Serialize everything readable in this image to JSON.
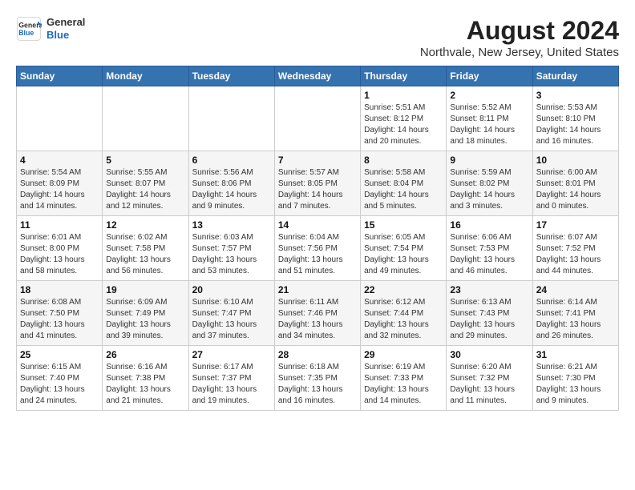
{
  "header": {
    "logo_line1": "General",
    "logo_line2": "Blue",
    "title": "August 2024",
    "subtitle": "Northvale, New Jersey, United States"
  },
  "weekdays": [
    "Sunday",
    "Monday",
    "Tuesday",
    "Wednesday",
    "Thursday",
    "Friday",
    "Saturday"
  ],
  "weeks": [
    [
      {
        "day": "",
        "info": ""
      },
      {
        "day": "",
        "info": ""
      },
      {
        "day": "",
        "info": ""
      },
      {
        "day": "",
        "info": ""
      },
      {
        "day": "1",
        "info": "Sunrise: 5:51 AM\nSunset: 8:12 PM\nDaylight: 14 hours\nand 20 minutes."
      },
      {
        "day": "2",
        "info": "Sunrise: 5:52 AM\nSunset: 8:11 PM\nDaylight: 14 hours\nand 18 minutes."
      },
      {
        "day": "3",
        "info": "Sunrise: 5:53 AM\nSunset: 8:10 PM\nDaylight: 14 hours\nand 16 minutes."
      }
    ],
    [
      {
        "day": "4",
        "info": "Sunrise: 5:54 AM\nSunset: 8:09 PM\nDaylight: 14 hours\nand 14 minutes."
      },
      {
        "day": "5",
        "info": "Sunrise: 5:55 AM\nSunset: 8:07 PM\nDaylight: 14 hours\nand 12 minutes."
      },
      {
        "day": "6",
        "info": "Sunrise: 5:56 AM\nSunset: 8:06 PM\nDaylight: 14 hours\nand 9 minutes."
      },
      {
        "day": "7",
        "info": "Sunrise: 5:57 AM\nSunset: 8:05 PM\nDaylight: 14 hours\nand 7 minutes."
      },
      {
        "day": "8",
        "info": "Sunrise: 5:58 AM\nSunset: 8:04 PM\nDaylight: 14 hours\nand 5 minutes."
      },
      {
        "day": "9",
        "info": "Sunrise: 5:59 AM\nSunset: 8:02 PM\nDaylight: 14 hours\nand 3 minutes."
      },
      {
        "day": "10",
        "info": "Sunrise: 6:00 AM\nSunset: 8:01 PM\nDaylight: 14 hours\nand 0 minutes."
      }
    ],
    [
      {
        "day": "11",
        "info": "Sunrise: 6:01 AM\nSunset: 8:00 PM\nDaylight: 13 hours\nand 58 minutes."
      },
      {
        "day": "12",
        "info": "Sunrise: 6:02 AM\nSunset: 7:58 PM\nDaylight: 13 hours\nand 56 minutes."
      },
      {
        "day": "13",
        "info": "Sunrise: 6:03 AM\nSunset: 7:57 PM\nDaylight: 13 hours\nand 53 minutes."
      },
      {
        "day": "14",
        "info": "Sunrise: 6:04 AM\nSunset: 7:56 PM\nDaylight: 13 hours\nand 51 minutes."
      },
      {
        "day": "15",
        "info": "Sunrise: 6:05 AM\nSunset: 7:54 PM\nDaylight: 13 hours\nand 49 minutes."
      },
      {
        "day": "16",
        "info": "Sunrise: 6:06 AM\nSunset: 7:53 PM\nDaylight: 13 hours\nand 46 minutes."
      },
      {
        "day": "17",
        "info": "Sunrise: 6:07 AM\nSunset: 7:52 PM\nDaylight: 13 hours\nand 44 minutes."
      }
    ],
    [
      {
        "day": "18",
        "info": "Sunrise: 6:08 AM\nSunset: 7:50 PM\nDaylight: 13 hours\nand 41 minutes."
      },
      {
        "day": "19",
        "info": "Sunrise: 6:09 AM\nSunset: 7:49 PM\nDaylight: 13 hours\nand 39 minutes."
      },
      {
        "day": "20",
        "info": "Sunrise: 6:10 AM\nSunset: 7:47 PM\nDaylight: 13 hours\nand 37 minutes."
      },
      {
        "day": "21",
        "info": "Sunrise: 6:11 AM\nSunset: 7:46 PM\nDaylight: 13 hours\nand 34 minutes."
      },
      {
        "day": "22",
        "info": "Sunrise: 6:12 AM\nSunset: 7:44 PM\nDaylight: 13 hours\nand 32 minutes."
      },
      {
        "day": "23",
        "info": "Sunrise: 6:13 AM\nSunset: 7:43 PM\nDaylight: 13 hours\nand 29 minutes."
      },
      {
        "day": "24",
        "info": "Sunrise: 6:14 AM\nSunset: 7:41 PM\nDaylight: 13 hours\nand 26 minutes."
      }
    ],
    [
      {
        "day": "25",
        "info": "Sunrise: 6:15 AM\nSunset: 7:40 PM\nDaylight: 13 hours\nand 24 minutes."
      },
      {
        "day": "26",
        "info": "Sunrise: 6:16 AM\nSunset: 7:38 PM\nDaylight: 13 hours\nand 21 minutes."
      },
      {
        "day": "27",
        "info": "Sunrise: 6:17 AM\nSunset: 7:37 PM\nDaylight: 13 hours\nand 19 minutes."
      },
      {
        "day": "28",
        "info": "Sunrise: 6:18 AM\nSunset: 7:35 PM\nDaylight: 13 hours\nand 16 minutes."
      },
      {
        "day": "29",
        "info": "Sunrise: 6:19 AM\nSunset: 7:33 PM\nDaylight: 13 hours\nand 14 minutes."
      },
      {
        "day": "30",
        "info": "Sunrise: 6:20 AM\nSunset: 7:32 PM\nDaylight: 13 hours\nand 11 minutes."
      },
      {
        "day": "31",
        "info": "Sunrise: 6:21 AM\nSunset: 7:30 PM\nDaylight: 13 hours\nand 9 minutes."
      }
    ]
  ]
}
